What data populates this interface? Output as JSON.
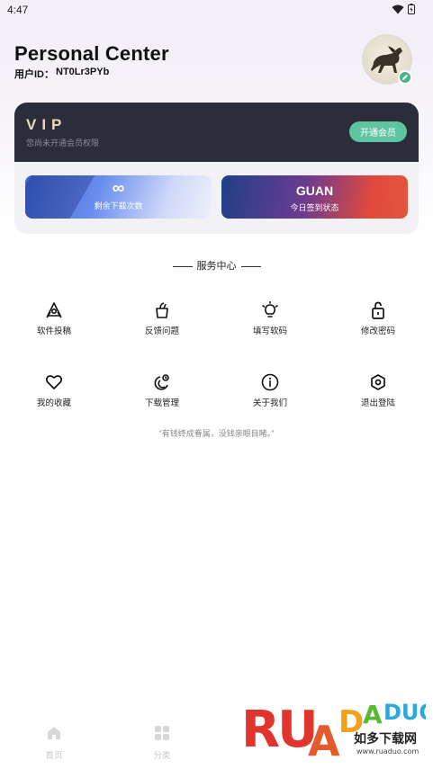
{
  "status": {
    "time": "4:47"
  },
  "header": {
    "title": "Personal Center",
    "user_id_label": "用户ID：",
    "user_id": "NT0Lr3PYb"
  },
  "vip": {
    "title": "VIP",
    "subtitle": "您尚未开通会员权限",
    "open_button": "开通会员",
    "stats": [
      {
        "value": "∞",
        "label": "剩余下载次数"
      },
      {
        "value": "GUAN",
        "label": "今日签到状态"
      }
    ]
  },
  "services": {
    "title": "服务中心",
    "items": [
      {
        "label": "软件投稿",
        "icon": "app-submit-icon"
      },
      {
        "label": "反馈问题",
        "icon": "feedback-icon"
      },
      {
        "label": "填写软码",
        "icon": "lightbulb-icon"
      },
      {
        "label": "修改密码",
        "icon": "lock-icon"
      },
      {
        "label": "我的收藏",
        "icon": "heart-icon"
      },
      {
        "label": "下载管理",
        "icon": "download-manage-icon"
      },
      {
        "label": "关于我们",
        "icon": "info-icon"
      },
      {
        "label": "退出登陆",
        "icon": "logout-icon"
      }
    ],
    "quote": "“有钱终成眷属，没钱亲眼目睹。”"
  },
  "nav": {
    "items": [
      {
        "label": "首页",
        "icon": "home-icon"
      },
      {
        "label": "分类",
        "icon": "category-icon"
      }
    ]
  },
  "watermark": {
    "logo_text": "RUANDADUO",
    "cn": "如多下载网",
    "url": "www.ruaduo.com"
  },
  "colors": {
    "vip_bg": "#2c2d3b",
    "accent_green": "#5fc4a0",
    "vip_gold": "#e9d8b5"
  }
}
